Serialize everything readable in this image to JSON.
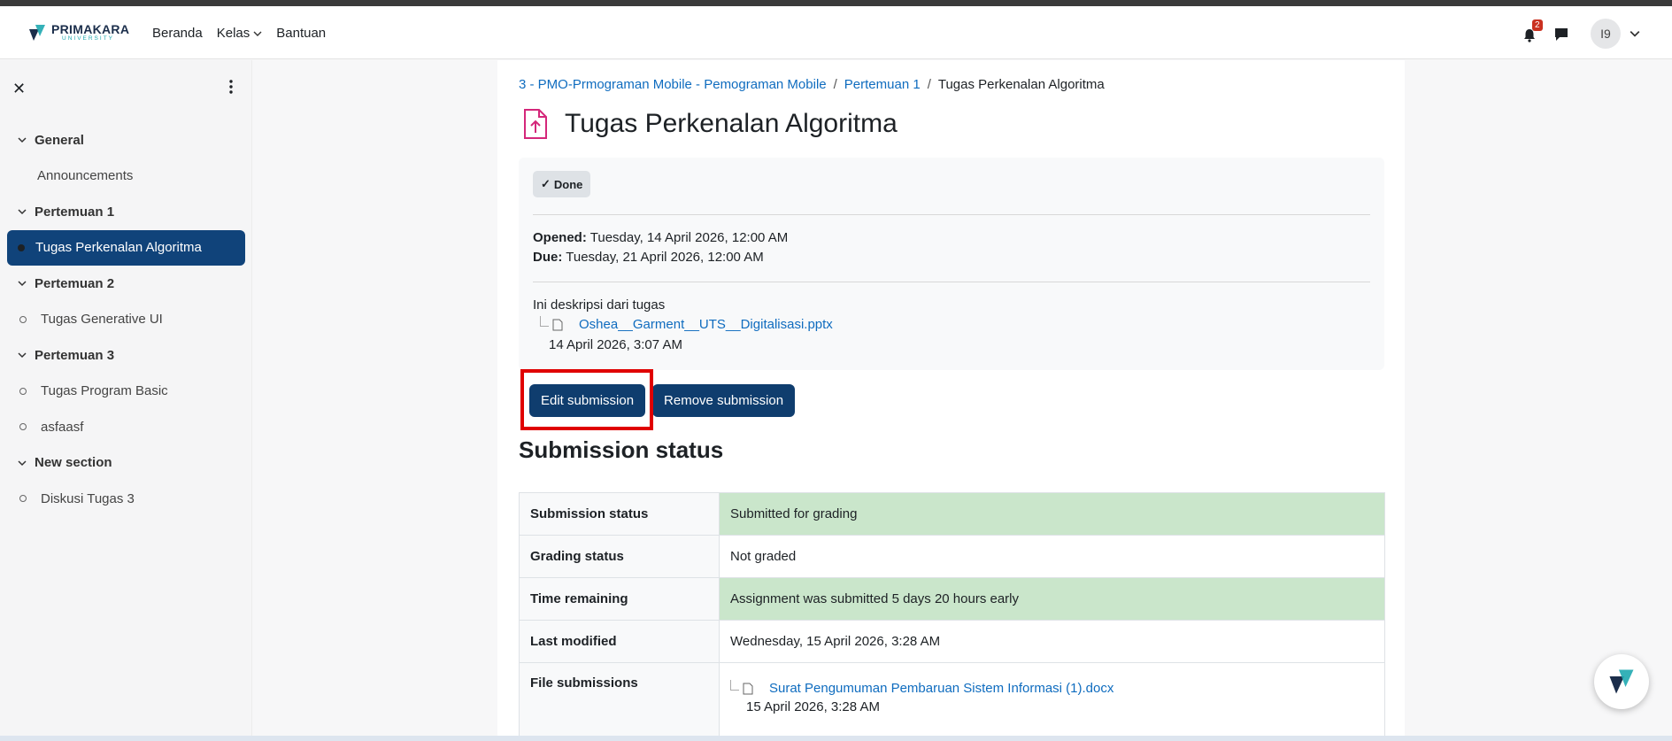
{
  "brand": {
    "name": "PRIMAKARA",
    "sub": "UNIVERSITY"
  },
  "nav": {
    "home": "Beranda",
    "classes": "Kelas",
    "help": "Bantuan"
  },
  "user": {
    "initials": "I9",
    "notification_count": "2"
  },
  "drawer": {
    "close": "✕",
    "sections": [
      {
        "title": "General",
        "items": [
          {
            "label": "Announcements"
          }
        ]
      },
      {
        "title": "Pertemuan 1",
        "items": [
          {
            "label": "Tugas Perkenalan Algoritma"
          }
        ]
      },
      {
        "title": "Pertemuan 2",
        "items": [
          {
            "label": "Tugas Generative UI"
          }
        ]
      },
      {
        "title": "Pertemuan 3",
        "items": [
          {
            "label": "Tugas Program Basic"
          },
          {
            "label": "asfaasf"
          }
        ]
      },
      {
        "title": "New section",
        "items": [
          {
            "label": "Diskusi Tugas 3"
          }
        ]
      }
    ]
  },
  "breadcrumb": {
    "course": "3 - PMO-Prmograman Mobile - Pemograman Mobile",
    "section": "Pertemuan 1",
    "current": "Tugas Perkenalan Algoritma",
    "sep": "/"
  },
  "page_title": "Tugas Perkenalan Algoritma",
  "completion": {
    "label": "Done",
    "check": "✓"
  },
  "dates": {
    "opened_label": "Opened:",
    "opened_value": "Tuesday, 14 April 2026, 12:00 AM",
    "due_label": "Due:",
    "due_value": "Tuesday, 21 April 2026, 12:00 AM"
  },
  "description": "Ini deskripsi dari tugas",
  "attachment": {
    "name": "Oshea__Garment__UTS__Digitalisasi.pptx",
    "date": "14 April 2026, 3:07 AM"
  },
  "buttons": {
    "edit": "Edit submission",
    "remove": "Remove submission"
  },
  "submission": {
    "title": "Submission status",
    "rows": [
      {
        "label": "Submission status",
        "value": "Submitted for grading"
      },
      {
        "label": "Grading status",
        "value": "Not graded"
      },
      {
        "label": "Time remaining",
        "value": "Assignment was submitted 5 days 20 hours early"
      },
      {
        "label": "Last modified",
        "value": "Wednesday, 15 April 2026, 3:28 AM"
      },
      {
        "label": "File submissions"
      }
    ],
    "file": {
      "name": "Surat Pengumuman Pembaruan Sistem Informasi (1).docx",
      "date": "15 April 2026, 3:28 AM"
    }
  },
  "colors": {
    "accent": "#10437a",
    "link": "#0f6cbf",
    "success": "#cae6cb",
    "highlight": "#e00000"
  }
}
